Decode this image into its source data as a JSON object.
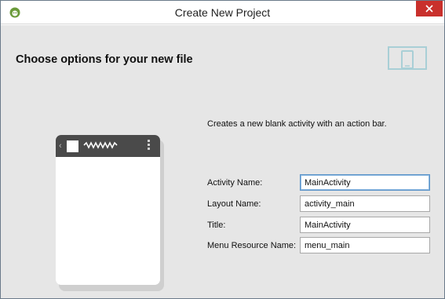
{
  "window": {
    "title": "Create New Project"
  },
  "page": {
    "heading": "Choose options for your new file",
    "description": "Creates a new blank activity with an action bar."
  },
  "form": {
    "fields": [
      {
        "label": "Activity Name:",
        "value": "MainActivity",
        "focused": true
      },
      {
        "label": "Layout Name:",
        "value": "activity_main",
        "focused": false
      },
      {
        "label": "Title:",
        "value": "MainActivity",
        "focused": false
      },
      {
        "label": "Menu Resource Name:",
        "value": "menu_main",
        "focused": false
      }
    ]
  },
  "icons": {
    "app": "android-studio-icon",
    "close": "close-icon",
    "device": "device-form-factor-icon"
  },
  "colors": {
    "close_button": "#c9302c",
    "content_background": "#e6e6e6",
    "phone_action_bar": "#4a4a4a",
    "focus_border": "#5b93c8"
  }
}
